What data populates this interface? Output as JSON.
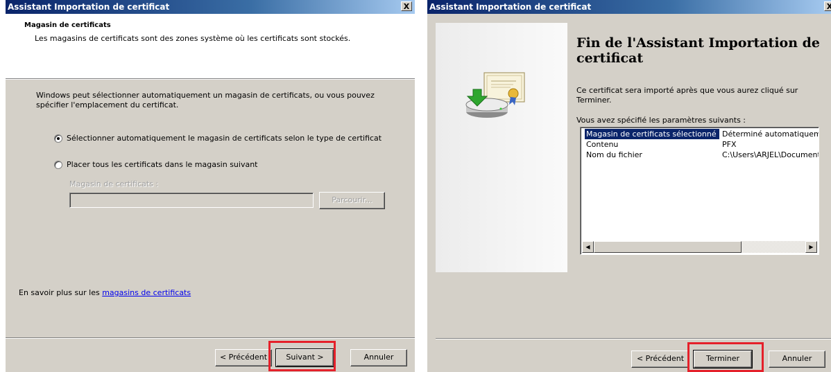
{
  "window1": {
    "title": "Assistant Importation de certificat",
    "close_label": "X",
    "header_title": "Magasin de certificats",
    "header_subtitle": "Les magasins de certificats sont des zones système où les certificats sont stockés.",
    "intro": "Windows peut sélectionner automatiquement un magasin de certificats, ou vous pouvez spécifier l'emplacement du certificat.",
    "radio_auto_label": "Sélectionner automatiquement le magasin de certificats selon le type de certificat",
    "radio_auto_selected": true,
    "radio_manual_label": "Placer tous les certificats dans le magasin suivant",
    "store_label": "Magasin de certificats :",
    "store_value": "",
    "browse_label": "Parcourir...",
    "learn_more_prefix": "En savoir plus sur les ",
    "learn_more_link": "magasins de certificats",
    "back_label": "< Précédent",
    "next_label": "Suivant >",
    "cancel_label": "Annuler"
  },
  "window2": {
    "title": "Assistant Importation de certificat",
    "close_label": "X",
    "heading": "Fin de l'Assistant Importation de certificat",
    "description": "Ce certificat sera importé après que vous aurez cliqué sur Terminer.",
    "settings_label": "Vous avez spécifié les paramètres suivants :",
    "settings_rows": [
      {
        "name": "Magasin de certificats sélectionné",
        "value": "Déterminé automatiquement"
      },
      {
        "name": "Contenu",
        "value": "PFX"
      },
      {
        "name": "Nom du fichier",
        "value": "C:\\Users\\ARJEL\\Documents"
      }
    ],
    "scroll_left": "◀",
    "scroll_right": "▶",
    "back_label": "< Précédent",
    "finish_label": "Terminer",
    "cancel_label": "Annuler"
  },
  "colors": {
    "highlight": "#e5202a",
    "title_bar": "#0a246a",
    "dialog_bg": "#d4d0c8",
    "selection": "#0a246a"
  },
  "icons": [
    "close-icon",
    "certificate-import-icon",
    "radio-selected",
    "radio-unselected",
    "scroll-left-arrow",
    "scroll-right-arrow"
  ]
}
